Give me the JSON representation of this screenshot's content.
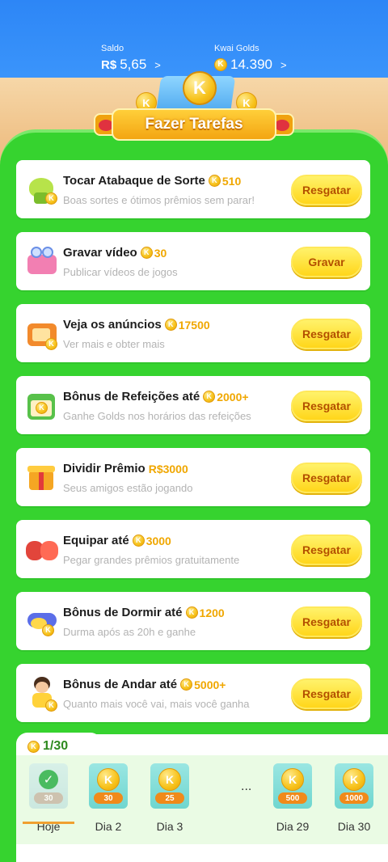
{
  "header": {
    "saldo_label": "Saldo",
    "saldo_currency": "R$",
    "saldo_value": "5,65",
    "golds_label": "Kwai Golds",
    "golds_value": "14.390",
    "chevron": ">"
  },
  "banner": {
    "title": "Fazer Tarefas",
    "coin_letter": "K"
  },
  "tasks": [
    {
      "title": "Tocar Atabaque de Sorte",
      "reward": "510",
      "subtitle": "Boas sortes e ótimos prêmios sem parar!",
      "button": "Resgatar"
    },
    {
      "title": "Gravar vídeo",
      "reward": "30",
      "subtitle": "Publicar vídeos de jogos",
      "button": "Gravar"
    },
    {
      "title": "Veja os anúncios",
      "reward": "17500",
      "subtitle": "Ver mais e obter mais",
      "button": "Resgatar"
    },
    {
      "title": "Bônus de Refeições até",
      "reward": "2000+",
      "subtitle": "Ganhe Golds nos horários das refeições",
      "button": "Resgatar"
    },
    {
      "title": "Dividir Prêmio",
      "reward": "R$3000",
      "subtitle": "Seus amigos estão jogando",
      "button": "Resgatar"
    },
    {
      "title": "Equipar até",
      "reward": "3000",
      "subtitle": "Pegar grandes prêmios gratuitamente",
      "button": "Resgatar"
    },
    {
      "title": "Bônus de Dormir até",
      "reward": "1200",
      "subtitle": "Durma após as 20h e ganhe",
      "button": "Resgatar"
    },
    {
      "title": "Bônus de Andar até",
      "reward": "5000+",
      "subtitle": "Quanto mais você vai, mais você ganha",
      "button": "Resgatar"
    }
  ],
  "checkin": {
    "progress": "1/30",
    "ellipsis": "...",
    "days": [
      {
        "label": "Hoje",
        "amount": "30"
      },
      {
        "label": "Dia 2",
        "amount": "30"
      },
      {
        "label": "Dia 3",
        "amount": "25"
      },
      {
        "label": "Dia 29",
        "amount": "500"
      },
      {
        "label": "Dia 30",
        "amount": "1000"
      }
    ]
  },
  "colors": {
    "accent": "#36d32f",
    "header": "#2d86f6",
    "button": "#ffd61a",
    "reward": "#f0a700"
  },
  "icons": [
    "atabaque-icon",
    "video-record-icon",
    "tv-ads-icon",
    "meal-calendar-icon",
    "gift-box-icon",
    "boxing-gloves-icon",
    "sleep-moon-icon",
    "walking-boy-icon",
    "gold-coin-icon",
    "checkmark-icon"
  ]
}
